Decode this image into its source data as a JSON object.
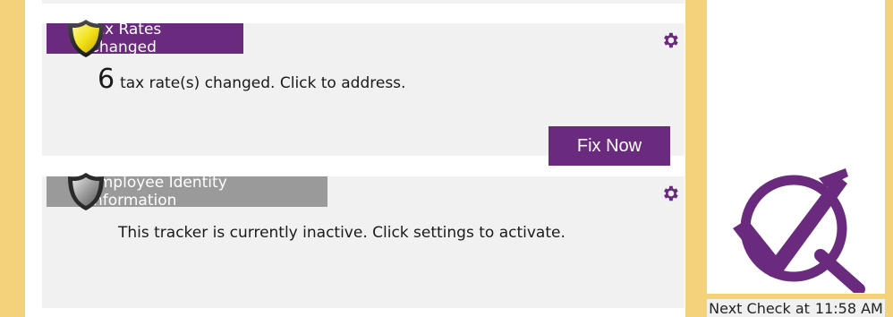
{
  "trackers": [
    {
      "title": "Tax Rates Changed",
      "count": "6",
      "message": "tax rate(s) changed. Click to address.",
      "action_label": "Fix Now",
      "status_color": "#6a2a7e",
      "shield_icon": "shield-yellow-icon"
    },
    {
      "title": "Employee Identity Information",
      "message": "This tracker is currently inactive. Click settings to activate.",
      "status_color": "#9a9a9a",
      "shield_icon": "shield-gray-icon"
    }
  ],
  "status": {
    "prefix": "Next Check at",
    "time": "11:58 AM"
  },
  "colors": {
    "accent": "#6a2a7e",
    "inactive": "#9a9a9a",
    "frame": "#f3d27a",
    "card_bg": "#f1f1f1"
  }
}
